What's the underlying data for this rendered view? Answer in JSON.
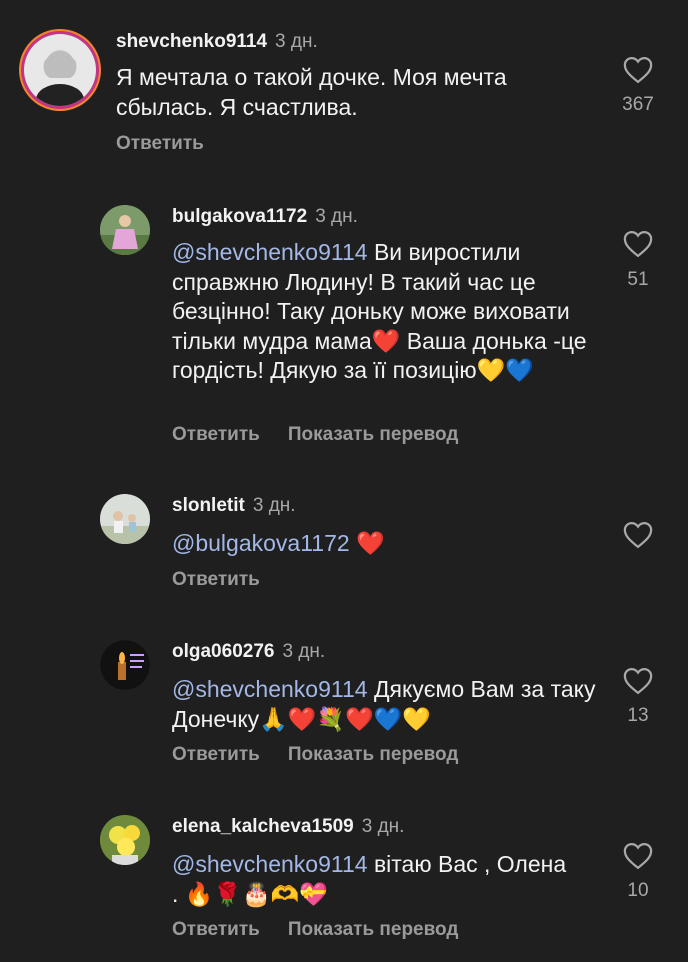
{
  "comments": [
    {
      "username": "shevchenko9114",
      "time": "3 дн.",
      "text": "Я мечтала о такой дочке. Моя мечта сбылась. Я счастлива.",
      "likes": "367",
      "actions": [
        "Ответить"
      ]
    },
    {
      "username": "bulgakova1172",
      "time": "3 дн.",
      "mention": "@shevchenko9114",
      "text": " Ви виростили справжню Людину!  В такий час це безцінно! Таку доньку може виховати тільки мудра мама❤️ Ваша донька -це гордість! Дякую за її позицію💛💙",
      "likes": "51",
      "actions": [
        "Ответить",
        "Показать перевод"
      ]
    },
    {
      "username": "slonletit",
      "time": "3 дн.",
      "mention": "@bulgakova1172",
      "text": " ❤️",
      "likes": "",
      "actions": [
        "Ответить"
      ]
    },
    {
      "username": "olga060276",
      "time": "3 дн.",
      "mention": "@shevchenko9114",
      "text": " Дякуємо Вам за таку Донечку🙏❤️💐❤️💙💛",
      "likes": "13",
      "actions": [
        "Ответить",
        "Показать перевод"
      ]
    },
    {
      "username": "elena_kalcheva1509",
      "time": "3 дн.",
      "mention": "@shevchenko9114",
      "text": " вітаю Вас , Олена . 🔥🌹🎂🫶💝",
      "likes": "10",
      "actions": [
        "Ответить",
        "Показать перевод"
      ]
    }
  ],
  "icons": {
    "like": "heart-outline-icon"
  },
  "colors": {
    "background": "#1f1f1f",
    "mention": "#a3b8e6",
    "secondary": "#a8a8a8"
  }
}
